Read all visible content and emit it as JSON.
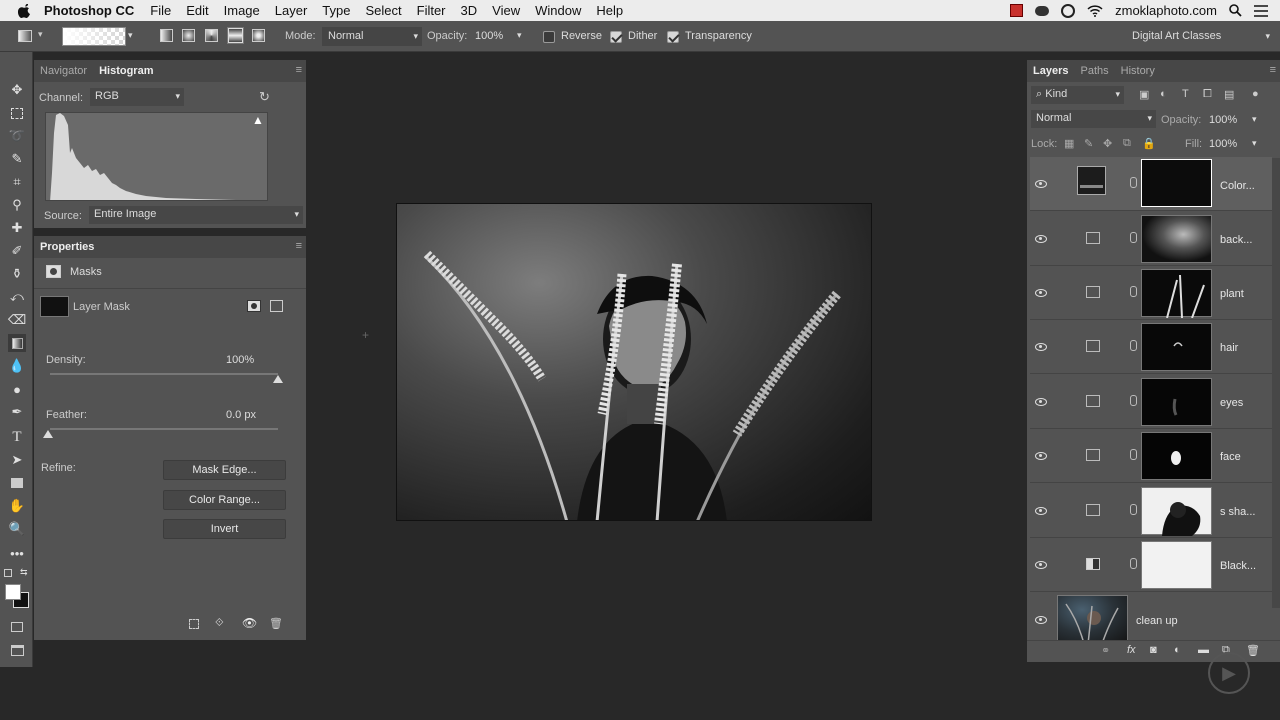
{
  "menubar": {
    "app_name": "Photoshop CC",
    "items": [
      "File",
      "Edit",
      "Image",
      "Layer",
      "Type",
      "Select",
      "Filter",
      "3D",
      "View",
      "Window",
      "Help"
    ],
    "site": "zmoklaphoto.com"
  },
  "options": {
    "mode_label": "Mode:",
    "mode_value": "Normal",
    "opacity_label": "Opacity:",
    "opacity_value": "100%",
    "reverse_label": "Reverse",
    "dither_label": "Dither",
    "transparency_label": "Transparency",
    "workspace": "Digital Art Classes",
    "reverse_checked": false,
    "dither_checked": true,
    "transparency_checked": true
  },
  "histogram_panel": {
    "tabs": [
      "Navigator",
      "Histogram"
    ],
    "channel_label": "Channel:",
    "channel_value": "RGB",
    "source_label": "Source:",
    "source_value": "Entire Image"
  },
  "properties_panel": {
    "title": "Properties",
    "section": "Masks",
    "mask_label": "Layer Mask",
    "density_label": "Density:",
    "density_value": "100%",
    "density": 1.0,
    "feather_label": "Feather:",
    "feather_value": "0.0 px",
    "feather": 0.0,
    "refine_label": "Refine:",
    "mask_edge_button": "Mask Edge...",
    "color_range_button": "Color Range...",
    "invert_button": "Invert"
  },
  "layers_panel": {
    "tabs": [
      "Layers",
      "Paths",
      "History"
    ],
    "filter_value": "Kind",
    "blend_mode": "Normal",
    "opacity_label": "Opacity:",
    "opacity_value": "100%",
    "lock_label": "Lock:",
    "fill_label": "Fill:",
    "fill_value": "100%",
    "layers": [
      {
        "name": "Color...",
        "mask": "black",
        "type": "solid",
        "selected": true
      },
      {
        "name": "back...",
        "mask": "soft",
        "type": "curves",
        "selected": false
      },
      {
        "name": "plant",
        "mask": "plant",
        "type": "curves",
        "selected": false
      },
      {
        "name": "hair",
        "mask": "hair",
        "type": "curves",
        "selected": false
      },
      {
        "name": "eyes",
        "mask": "eyes",
        "type": "curves",
        "selected": false
      },
      {
        "name": "face",
        "mask": "face",
        "type": "curves",
        "selected": false
      },
      {
        "name": "s sha...",
        "mask": "shadow",
        "type": "curves",
        "selected": false
      },
      {
        "name": "Black...",
        "mask": "white",
        "type": "bw",
        "selected": false
      },
      {
        "name": "clean up",
        "mask": "photo",
        "type": "pixel",
        "selected": false
      }
    ]
  },
  "colors": {
    "ui_bg": "#535353",
    "canvas_bg": "#282828",
    "selection": "#5f5f5f"
  }
}
